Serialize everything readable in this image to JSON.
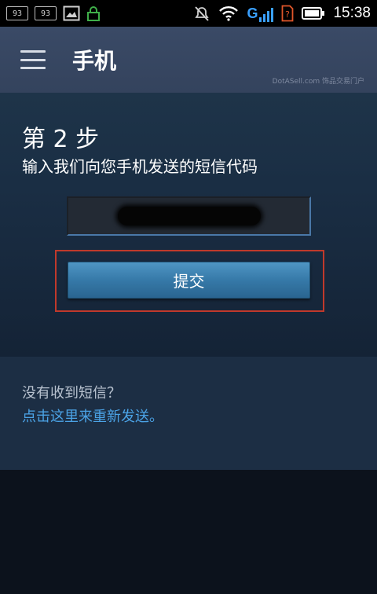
{
  "status_bar": {
    "sim1_label": "93",
    "sim2_label": "93",
    "network_letter": "G",
    "time": "15:38"
  },
  "header": {
    "title": "手机",
    "watermark": "DotASell.com 饰品交易门户"
  },
  "step": {
    "title": "第 2 步",
    "description": "输入我们向您手机发送的短信代码",
    "code_value": "",
    "submit_label": "提交"
  },
  "resend": {
    "question": "没有收到短信？",
    "link_text": "点击这里来重新发送。"
  },
  "colors": {
    "header_bg": "#38475f",
    "accent_button": "#3679a8",
    "link": "#4ba3e6",
    "highlight": "#c0392b"
  }
}
